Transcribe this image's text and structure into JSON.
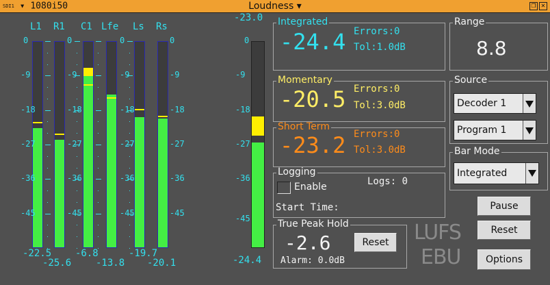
{
  "titlebar": {
    "input": "SDI1",
    "format": "1080i50",
    "title": "Loudness",
    "arrow": "▾"
  },
  "meters": {
    "channels": [
      {
        "label": "L1",
        "level": -22.5,
        "peak": -21.0
      },
      {
        "label": "R1",
        "level": -25.6,
        "peak": -24.0
      },
      {
        "label": "C1",
        "level": -6.8,
        "peak": -11.0
      },
      {
        "label": "Lfe",
        "level": -13.8,
        "peak": -14.5
      },
      {
        "label": "Ls",
        "level": -19.7,
        "peak": -17.5
      },
      {
        "label": "Rs",
        "level": -20.1,
        "peak": -19.3
      }
    ],
    "values_top": [
      "-22.5",
      "-6.8",
      "-19.7"
    ],
    "values_bottom": [
      "-25.6",
      "-13.8",
      "-20.1"
    ],
    "scale": [
      "0",
      "-9",
      "-18",
      "-27",
      "-36",
      "-45"
    ],
    "colors": {
      "safe": "#44ee44",
      "warn": "#ffee00",
      "scale": "#33e0ee"
    }
  },
  "loudness_bar": {
    "top_label": "-23.0",
    "bottom_label": "-24.4",
    "scale": [
      "0",
      "-9",
      "-18",
      "-27",
      "-36",
      "-45"
    ],
    "level": -24.4,
    "target": -23.0
  },
  "integrated": {
    "title": "Integrated",
    "value": "-24.4",
    "errors": "Errors:0",
    "tol": "Tol:1.0dB",
    "color": "#33e0ee"
  },
  "momentary": {
    "title": "Momentary",
    "value": "-20.5",
    "errors": "Errors:0",
    "tol": "Tol:3.0dB",
    "color": "#ffee66"
  },
  "shortterm": {
    "title": "Short Term",
    "value": "-23.2",
    "errors": "Errors:0",
    "tol": "Tol:3.0dB",
    "color": "#ff8c1a"
  },
  "logging": {
    "title": "Logging",
    "enable_label": "Enable",
    "logs": "Logs: 0",
    "start_time": "Start Time:"
  },
  "truepeak": {
    "title": "True Peak Hold",
    "value": "-2.6",
    "reset": "Reset",
    "alarm": "Alarm: 0.0dB"
  },
  "range": {
    "title": "Range",
    "value": "8.8"
  },
  "source": {
    "title": "Source",
    "decoder": "Decoder 1",
    "program": "Program 1"
  },
  "barmode": {
    "title": "Bar Mode",
    "value": "Integrated"
  },
  "buttons": {
    "pause": "Pause",
    "reset": "Reset",
    "options": "Options"
  },
  "logo": {
    "line1": "LUFS",
    "line2": "EBU"
  }
}
